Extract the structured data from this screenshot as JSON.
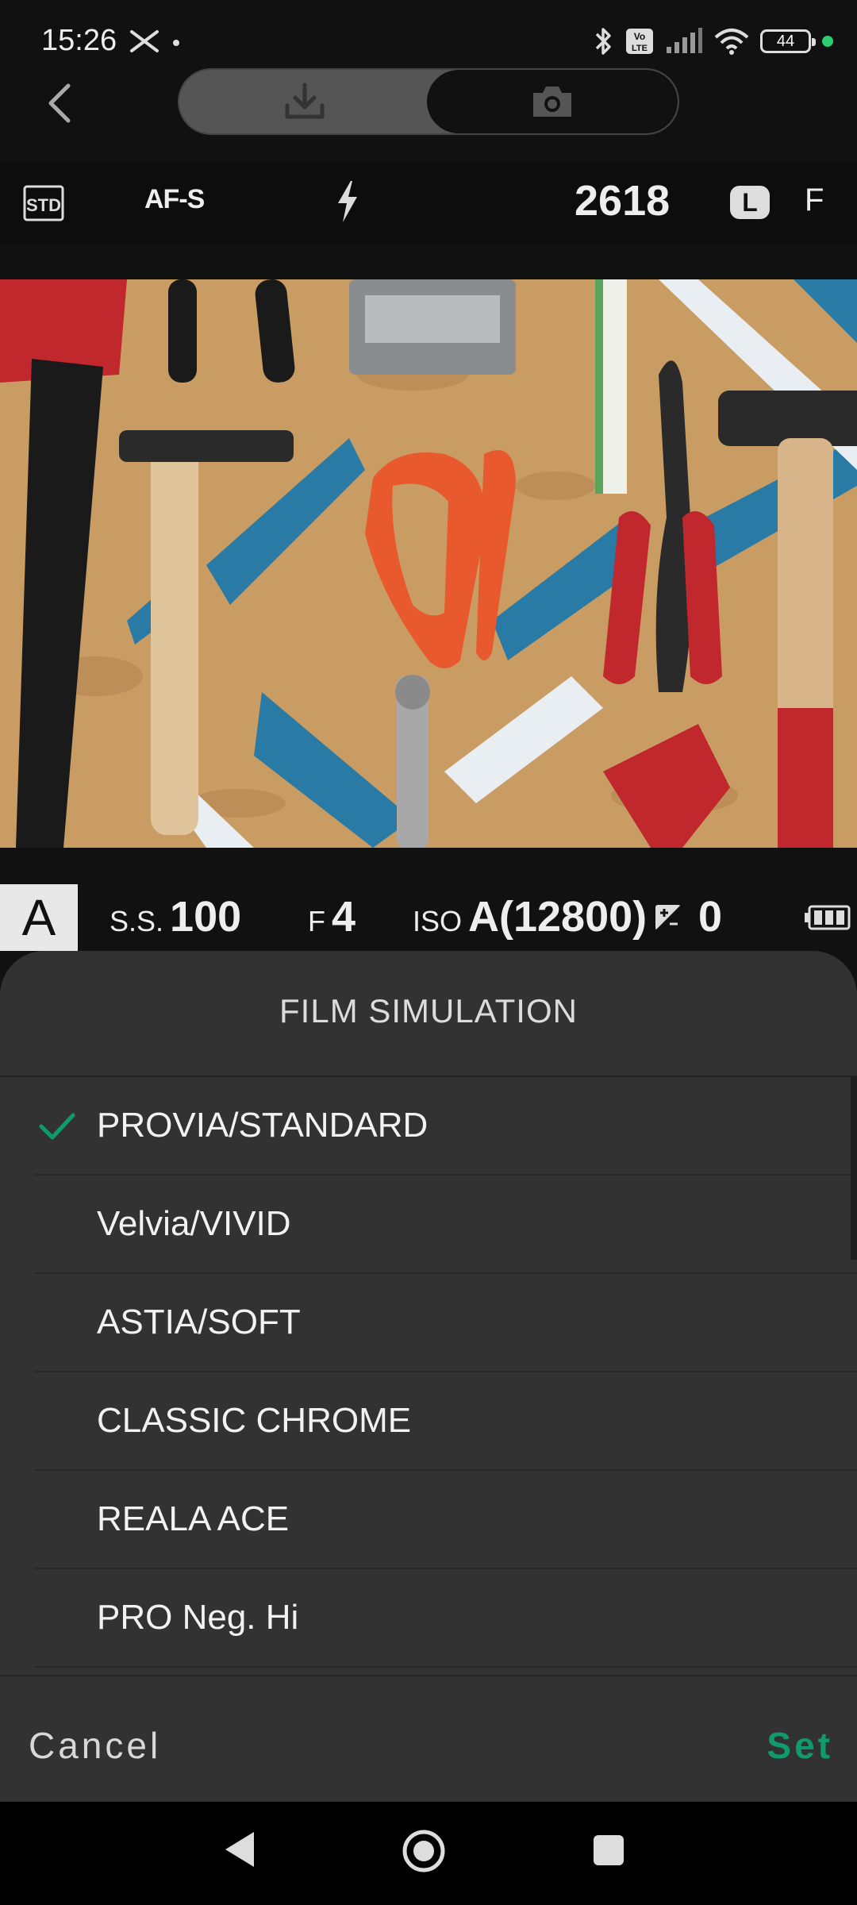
{
  "status_bar": {
    "time": "15:26",
    "battery": "44",
    "lte_label": "Vo LTE",
    "indicator_color": "#2ecc71"
  },
  "header": {
    "tabs": [
      {
        "name": "download-icon",
        "selected": false
      },
      {
        "name": "camera-icon",
        "selected": true
      }
    ]
  },
  "camera_info": {
    "film_badge": "STD",
    "focus_mode": "AF-S",
    "shots_remaining": "2618",
    "image_size": "L",
    "image_quality": "F"
  },
  "exposure": {
    "mode": "A",
    "shutter_label": "S.S.",
    "shutter_value": "100",
    "aperture_label": "F",
    "aperture_value": "4",
    "iso_label": "ISO",
    "iso_value": "A(12800)",
    "ev_value": "0",
    "battery_level": 1.0
  },
  "film_simulation": {
    "title": "FILM SIMULATION",
    "items": [
      {
        "label": "PROVIA/STANDARD",
        "selected": true
      },
      {
        "label": "Velvia/VIVID",
        "selected": false
      },
      {
        "label": "ASTIA/SOFT",
        "selected": false
      },
      {
        "label": "CLASSIC CHROME",
        "selected": false
      },
      {
        "label": "REALA ACE",
        "selected": false
      },
      {
        "label": "PRO Neg. Hi",
        "selected": false
      }
    ],
    "cancel_label": "Cancel",
    "set_label": "Set",
    "accent_color": "#0f9b6e"
  }
}
